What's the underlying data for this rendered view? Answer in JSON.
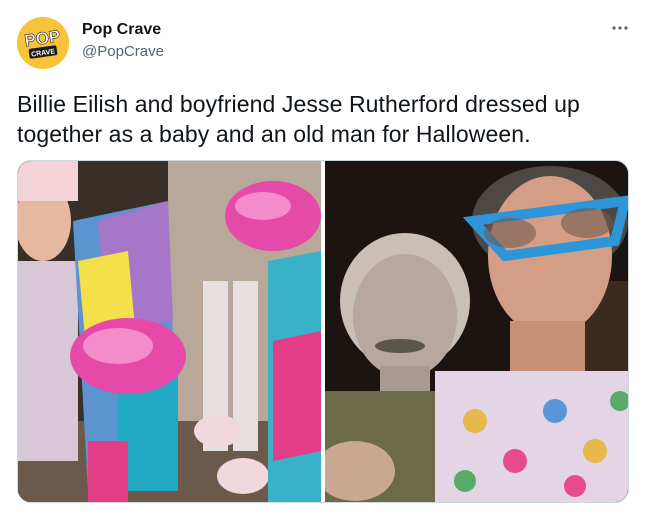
{
  "account": {
    "display_name": "Pop Crave",
    "handle": "@PopCrave",
    "avatar_text_top": "POP",
    "avatar_text_bottom": "CRAVE",
    "avatar_color": "#f8c33a"
  },
  "tweet": {
    "text": "Billie Eilish and boyfriend Jesse Rutherford dressed up together as a baby and an old man for Halloween."
  },
  "media": {
    "photo_count": 2
  },
  "colors": {
    "text_primary": "#0f1419",
    "text_secondary": "#536471",
    "border": "#cfd9de"
  },
  "icons": {
    "more": "more-horizontal-icon"
  }
}
